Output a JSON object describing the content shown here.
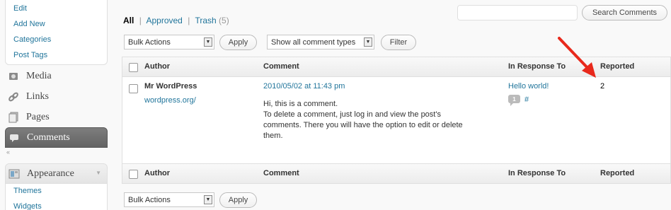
{
  "sidebar": {
    "posts_submenu": [
      "Edit",
      "Add New",
      "Categories",
      "Post Tags"
    ],
    "menu": [
      {
        "label": "Media",
        "icon": "media-icon"
      },
      {
        "label": "Links",
        "icon": "links-icon"
      },
      {
        "label": "Pages",
        "icon": "pages-icon"
      },
      {
        "label": "Comments",
        "icon": "comments-icon"
      }
    ],
    "appearance": {
      "label": "Appearance",
      "icon": "appearance-icon",
      "submenu": [
        "Themes",
        "Widgets"
      ]
    }
  },
  "filters": {
    "all": "All",
    "sep1": "|",
    "approved": "Approved",
    "sep2": "|",
    "trash": "Trash",
    "trash_count": "(5)"
  },
  "search": {
    "button_label": "Search Comments",
    "value": ""
  },
  "toolbar": {
    "bulk_actions": "Bulk Actions",
    "apply": "Apply",
    "comment_type": "Show all comment types",
    "filter": "Filter"
  },
  "table": {
    "headers": {
      "author": "Author",
      "comment": "Comment",
      "in_response_to": "In Response To",
      "reported": "Reported"
    },
    "rows": [
      {
        "author": "Mr WordPress",
        "author_url": "wordpress.org/",
        "date": "2010/05/02 at 11:43 pm",
        "text_line1": "Hi, this is a comment.",
        "text_line2": "To delete a comment, just log in and view the post's comments. There you will have the option to edit or delete them.",
        "response_post": "Hello world!",
        "response_count": "1",
        "response_hash": "#",
        "reported": "2"
      }
    ]
  },
  "colors": {
    "link": "#21759b",
    "arrow": "#e8291c",
    "current_menu": "#6d6d6d"
  }
}
